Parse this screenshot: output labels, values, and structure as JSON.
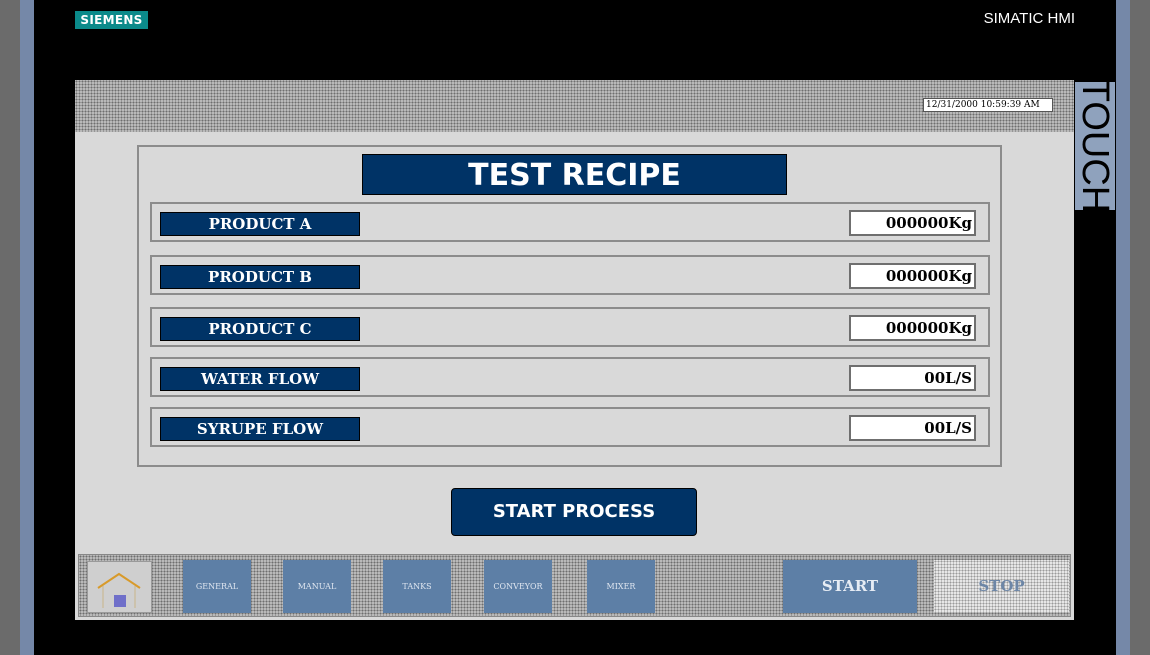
{
  "device": {
    "brand_logo": "SIEMENS",
    "model_label": "SIMATIC HMI",
    "side_label": "TOUCH"
  },
  "header": {
    "datetime": "12/31/2000 10:59:39 AM"
  },
  "recipe": {
    "title": "TEST RECIPE",
    "rows": [
      {
        "label": "PRODUCT A",
        "value": "000000Kg"
      },
      {
        "label": "PRODUCT B",
        "value": "000000Kg"
      },
      {
        "label": "PRODUCT C",
        "value": "000000Kg"
      },
      {
        "label": "WATER FLOW",
        "value": "00L/S"
      },
      {
        "label": "SYRUPE FLOW",
        "value": "00L/S"
      }
    ],
    "start_process_label": "START PROCESS"
  },
  "nav": {
    "home_icon": "home-icon",
    "buttons": [
      "GENERAL",
      "MANUAL",
      "TANKS",
      "CONVEYOR",
      "MIXER"
    ],
    "start_label": "START",
    "stop_label": "STOP"
  },
  "colors": {
    "accent_navy": "#003366",
    "nav_blue": "#5d7fa6",
    "logo_teal": "#0b8a8a"
  }
}
